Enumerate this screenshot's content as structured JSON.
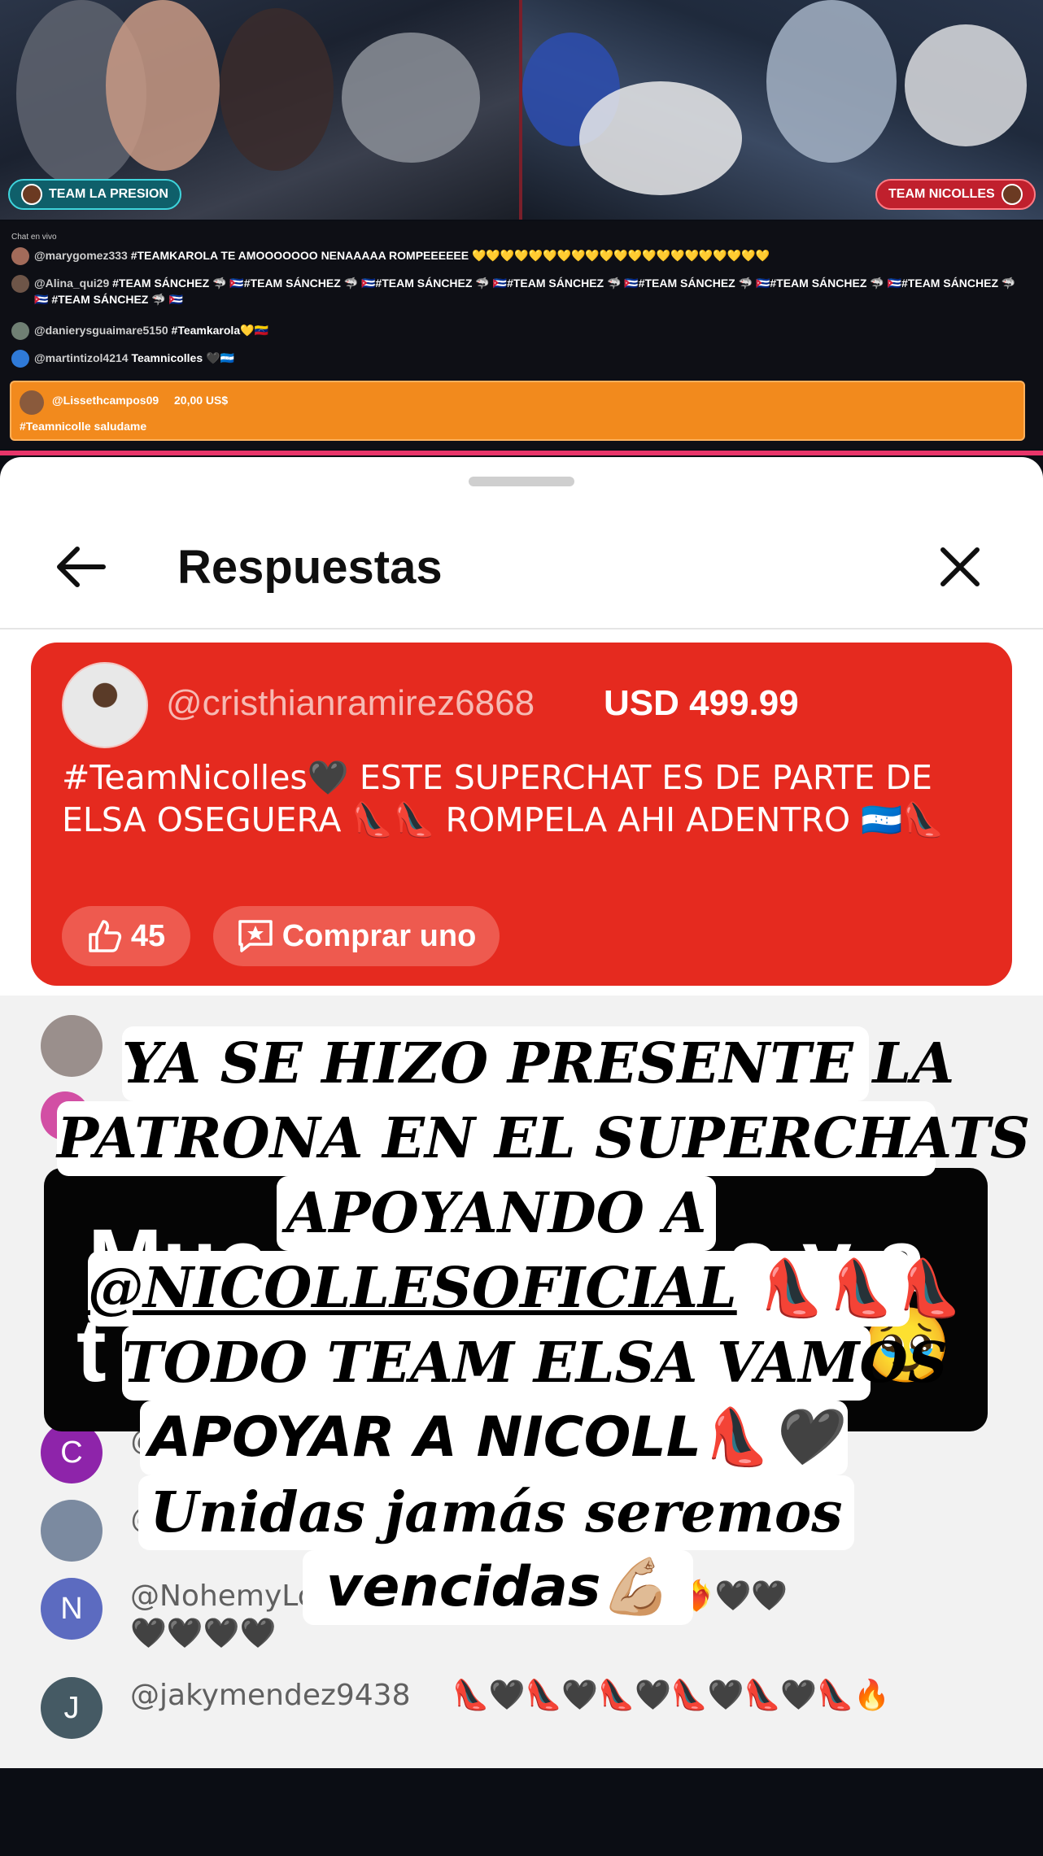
{
  "video": {
    "left_team": "TEAM LA PRESION",
    "right_team": "TEAM NICOLLES"
  },
  "live_chat": {
    "title": "Chat en vivo",
    "messages": [
      {
        "user": "@marygomez333",
        "text": "#TEAMKAROLA TE AMOOOOOOO NENAAAAA ROMPEEEEEE 💛💛💛💛💛💛💛💛💛💛💛💛💛💛💛💛💛💛💛💛💛"
      },
      {
        "user": "@Alina_qui29",
        "text": "#TEAM SÁNCHEZ 🦈 🇨🇺#TEAM SÁNCHEZ 🦈 🇨🇺#TEAM SÁNCHEZ 🦈 🇨🇺#TEAM SÁNCHEZ 🦈 🇨🇺#TEAM SÁNCHEZ 🦈 🇨🇺#TEAM SÁNCHEZ 🦈 🇨🇺#TEAM SÁNCHEZ 🦈 🇨🇺 #TEAM SÁNCHEZ 🦈 🇨🇺"
      },
      {
        "user": "@danierysguaimare5150",
        "text": "#Teamkarola💛🇻🇪"
      },
      {
        "user": "@martintizol4214",
        "text": "Teamnicolles 🖤🇭🇳"
      }
    ],
    "superchat": {
      "user": "@Lissethcampos09",
      "amount": "20,00 US$",
      "message": "#Teamnicolle saludame"
    }
  },
  "sheet": {
    "title": "Respuestas",
    "superchat_card": {
      "user": "@cristhianramirez6868",
      "amount": "USD 499.99",
      "message": "#TeamNicolles🖤 ESTE SUPERCHAT ES DE PARTE DE ELSA OSEGUERA 👠👠 ROMPELA AHI ADENTRO 🇭🇳👠",
      "likes": "45",
      "buy_label": "Comprar uno"
    },
    "replies": [
      {
        "initial": "C",
        "user": "@"
      },
      {
        "initial": "",
        "user": "@"
      },
      {
        "initial": "N",
        "user": "@NohemyLo",
        "tail": "❤️‍🔥❤️‍🔥❤️‍🔥❤️‍🔥🖤🖤",
        "line2": "🖤🖤🖤🖤"
      },
      {
        "initial": "J",
        "user": "@jakymendez9438",
        "tail": "👠🖤👠🖤👠🖤👠🖤👠🖤👠🔥"
      }
    ],
    "partial_bubble_text": "Muc",
    "partial_bubble_text_right": "s y a",
    "partial_bubble_text_bottom": "t"
  },
  "overlay_caption": {
    "line1": "YA SE HIZO PRESENTE LA",
    "line2": "PATRONA EN EL SUPERCHATS",
    "line3": "APOYANDO A",
    "line4_mention": "@NICOLLESOFICIAL",
    "line4_tail": " 👠👠👠",
    "line5": "TODO TEAM ELSA VAMOS",
    "line6": "APOYAR A NICOLL👠🖤",
    "line7": "Unidas jamás seremos",
    "line8": "vencidas💪🏼"
  },
  "colors": {
    "superchat_red": "#e52a1f",
    "live_superchat_orange": "#f28a1d",
    "team_left": "#0f5f6a",
    "team_right": "#c0202d"
  }
}
